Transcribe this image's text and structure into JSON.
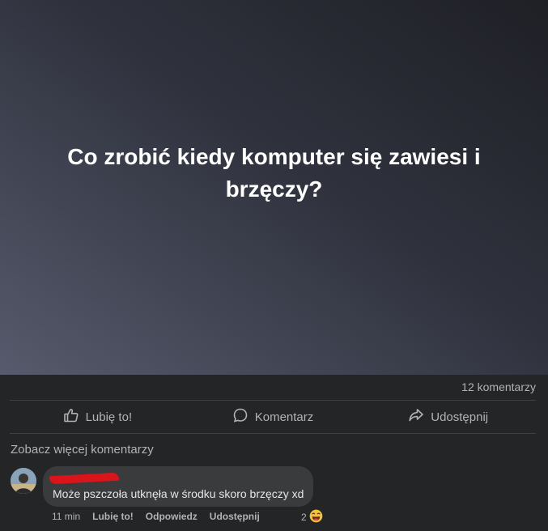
{
  "post": {
    "text": "Co zrobić kiedy komputer się zawiesi i brzęczy?",
    "comment_count": "12 komentarzy"
  },
  "actions": {
    "like": "Lubię to!",
    "comment": "Komentarz",
    "share": "Udostępnij"
  },
  "comments": {
    "see_more": "Zobacz więcej komentarzy",
    "items": [
      {
        "author": "",
        "text": "Może pszczoła utknęła w środku skoro brzęczy xd",
        "time": "11 min",
        "like": "Lubię to!",
        "reply": "Odpowiedz",
        "share": "Udostępnij",
        "reaction_count": "2",
        "reaction_icon": "laughing-emoji-icon"
      }
    ]
  },
  "colors": {
    "background": "#242526",
    "bubble": "#3a3b3c",
    "text_secondary": "#b0b3b8",
    "redaction": "#d9141b"
  }
}
